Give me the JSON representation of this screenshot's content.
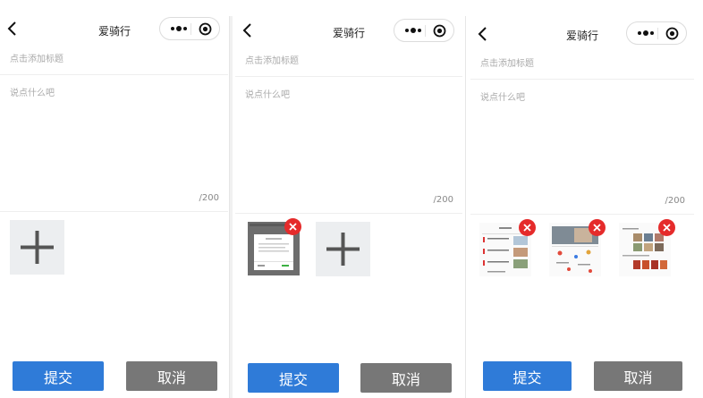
{
  "screens": [
    {
      "header": {
        "title": "爱骑行"
      },
      "form": {
        "title_placeholder": "点击添加标题",
        "content_placeholder": "说点什么吧",
        "counter": "/200"
      },
      "images": [],
      "actions": {
        "submit_label": "提交",
        "cancel_label": "取消"
      }
    },
    {
      "header": {
        "title": "爱骑行"
      },
      "form": {
        "title_placeholder": "点击添加标题",
        "content_placeholder": "说点什么吧",
        "counter": "/200"
      },
      "images": [
        {
          "kind": "dialog-screenshot"
        }
      ],
      "actions": {
        "submit_label": "提交",
        "cancel_label": "取消"
      }
    },
    {
      "header": {
        "title": "爱骑行"
      },
      "form": {
        "title_placeholder": "点击添加标题",
        "content_placeholder": "说点什么吧",
        "counter": "/200"
      },
      "images": [
        {
          "kind": "news-list-screenshot"
        },
        {
          "kind": "map-screenshot"
        },
        {
          "kind": "photo-grid-screenshot"
        }
      ],
      "actions": {
        "submit_label": "提交",
        "cancel_label": "取消"
      }
    }
  ],
  "colors": {
    "submit": "#2f7bd8",
    "cancel": "#777777",
    "delete": "#e52b2b",
    "add_box": "#eceef0"
  },
  "icons": {
    "back": "chevron-left-icon",
    "more": "more-dots-icon",
    "close": "target-close-icon",
    "add": "plus-icon",
    "delete": "close-x-icon"
  }
}
